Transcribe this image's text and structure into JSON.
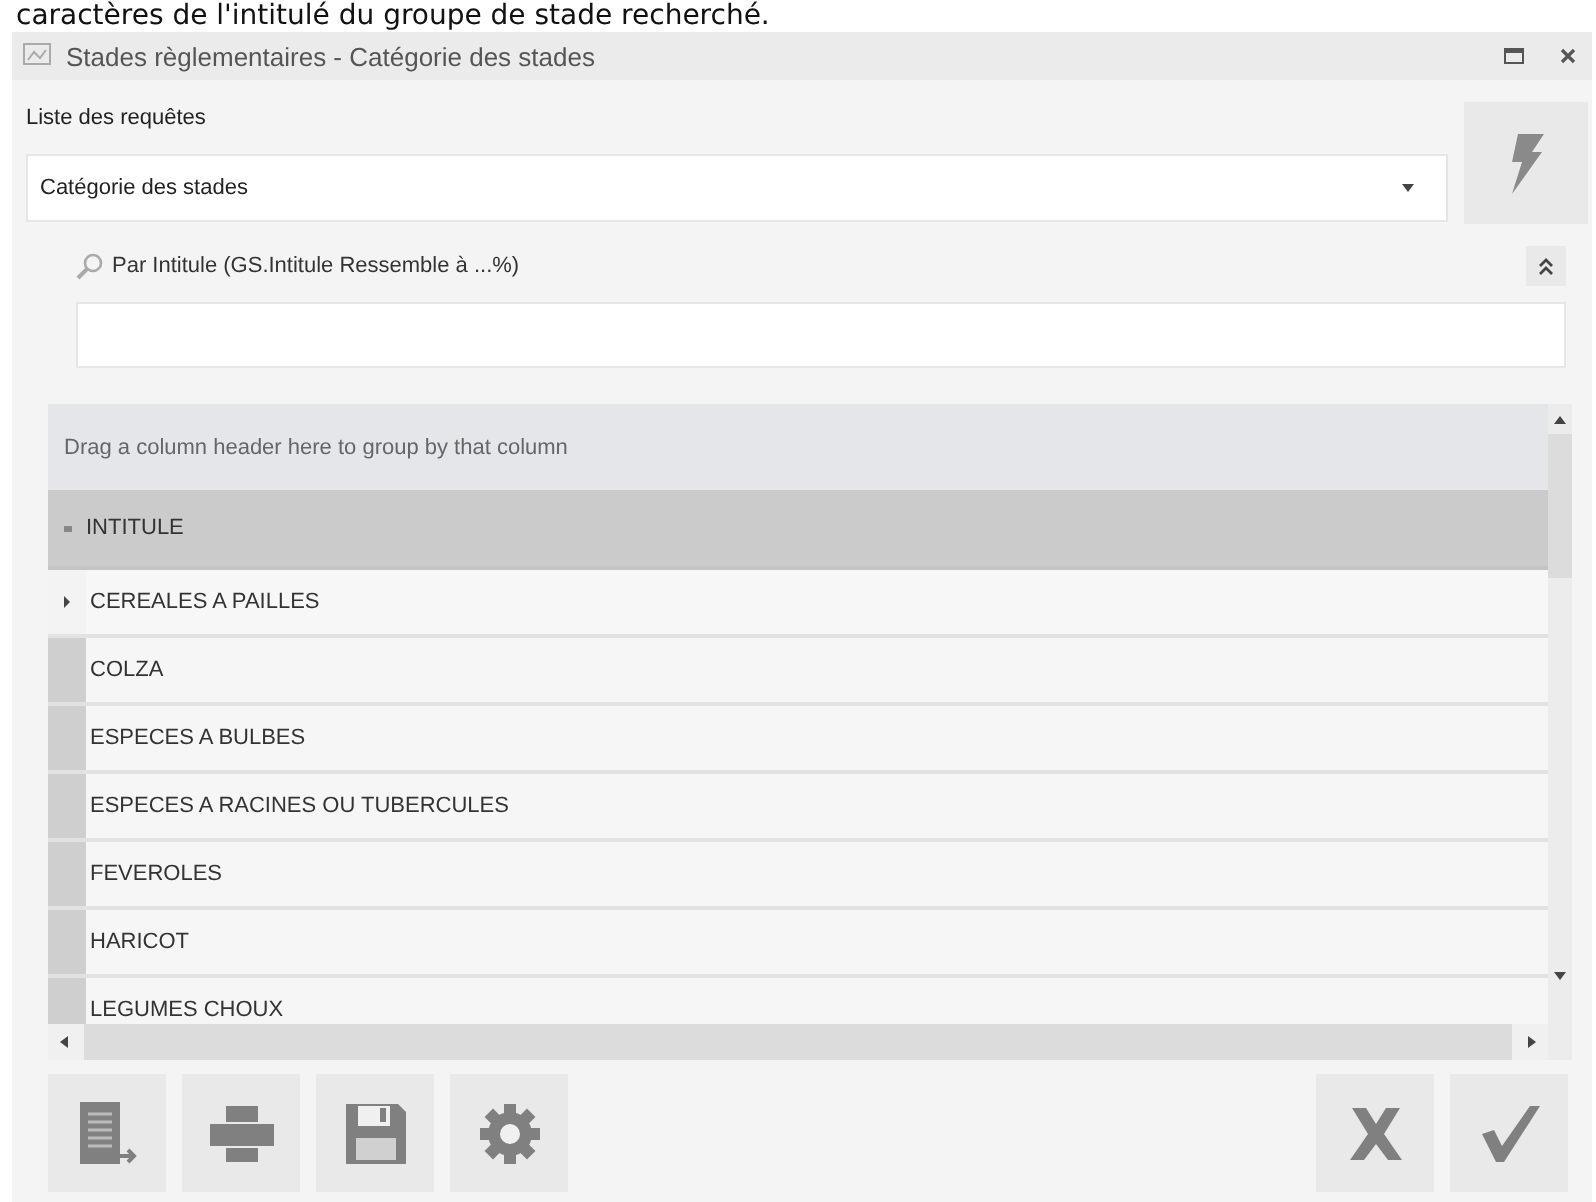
{
  "caption": "caractères de l'intitulé du groupe de stade recherché.",
  "window": {
    "title": "Stades règlementaires - Catégorie des stades"
  },
  "query_list": {
    "label": "Liste des requêtes",
    "value": "Catégorie des stades"
  },
  "filter": {
    "label": "Par Intitule (GS.Intitule Ressemble à ...%)"
  },
  "grid": {
    "group_panel": "Drag a column header here to group by that column",
    "columns": [
      "INTITULE"
    ],
    "rows": [
      {
        "cells": [
          "CEREALES A PAILLES"
        ],
        "selected": true
      },
      {
        "cells": [
          "COLZA"
        ],
        "selected": false
      },
      {
        "cells": [
          "ESPECES A BULBES"
        ],
        "selected": false
      },
      {
        "cells": [
          "ESPECES A RACINES OU TUBERCULES"
        ],
        "selected": false
      },
      {
        "cells": [
          "FEVEROLES"
        ],
        "selected": false
      },
      {
        "cells": [
          "HARICOT"
        ],
        "selected": false
      },
      {
        "cells": [
          "LEGUMES CHOUX"
        ],
        "selected": false
      }
    ]
  }
}
